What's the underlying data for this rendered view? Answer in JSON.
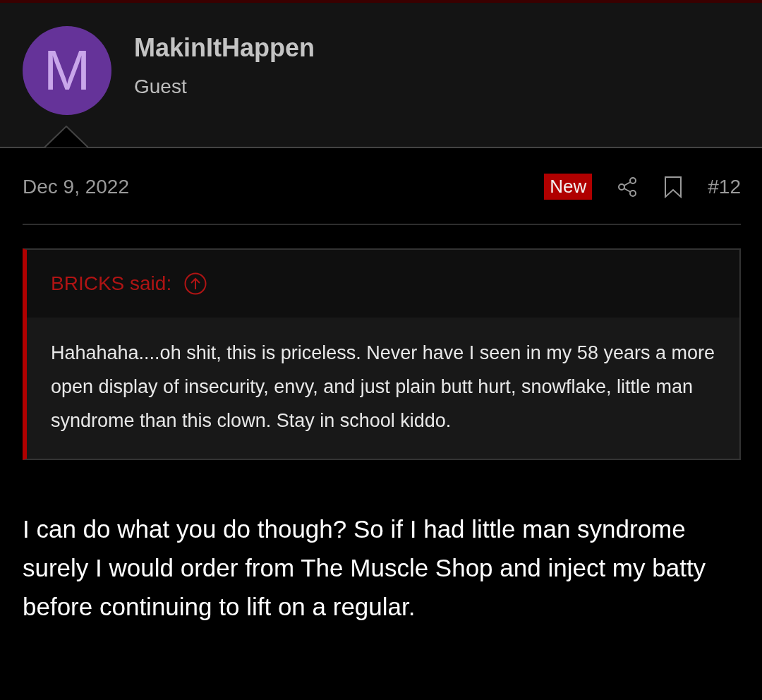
{
  "author": {
    "avatar_letter": "M",
    "name": "MakinItHappen",
    "title": "Guest"
  },
  "post": {
    "date": "Dec 9, 2022",
    "badge": "New",
    "number": "#12"
  },
  "quote": {
    "attribution": "BRICKS said:",
    "text": "Hahahaha....oh shit, this is priceless. Never have I seen in my 58 years a more open display of insecurity, envy, and just plain butt hurt, snowflake, little man syndrome than this clown. Stay in school kiddo."
  },
  "body": "I can do what you do though? So if I had little man syndrome surely I would order from The Muscle Shop and inject my batty before continuing to lift on a regular."
}
